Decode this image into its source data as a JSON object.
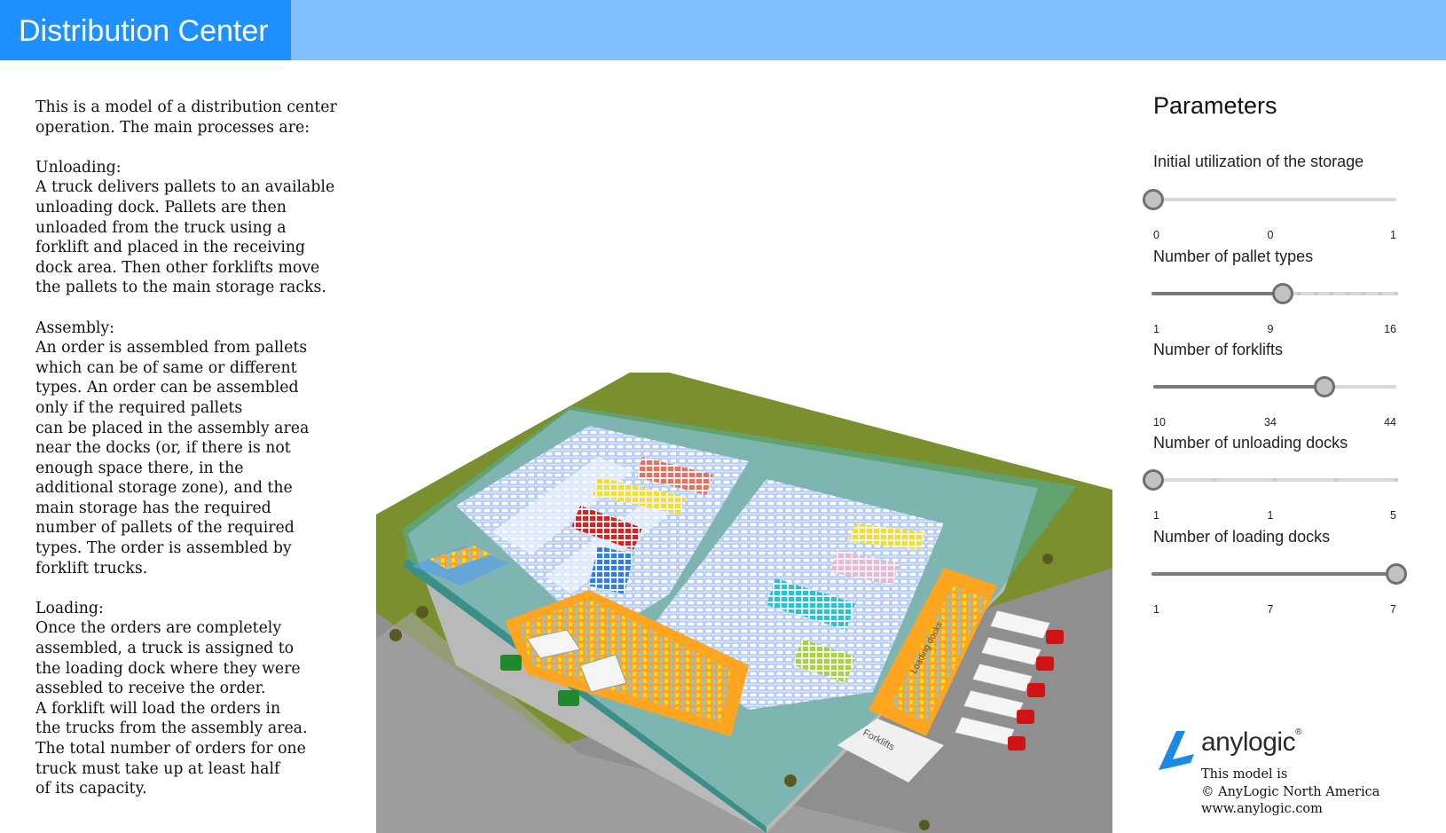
{
  "header": {
    "title": "Distribution Center"
  },
  "description": {
    "intro": "This is a model of a distribution center\noperation. The main processes are:",
    "unloading": "Unloading:\nA truck delivers pallets to an available\nunloading dock. Pallets are then\nunloaded from the truck using a\nforklift and placed in the receiving\ndock area. Then other forklifts move\nthe pallets to the main storage racks.",
    "assembly": "Assembly:\nAn order is assembled from pallets\nwhich can be of same or different\ntypes. An order can be assembled\nonly if the required pallets\ncan be placed in the assembly area\nnear the docks (or, if there is not\nenough space there, in the\nadditional storage zone), and the\nmain storage has the required\nnumber of pallets of the required\ntypes. The order is assembled by\nforklift trucks.",
    "loading": "Loading:\nOnce the orders are completely\nassembled, a truck is assigned to\nthe loading dock where they were\nassebled to receive the order.\nA forklift will load the orders in\nthe trucks from the assembly area.\nThe total number of orders for one\ntruck must take up at least half\nof its capacity."
  },
  "scene": {
    "forklifts_zone_label": "Forklifts",
    "loading_docks_label": "Loading docks"
  },
  "parameters": {
    "title": "Parameters",
    "items": [
      {
        "label": "Initial utilization of the storage",
        "min": "0",
        "value": "0",
        "max": "1",
        "fraction": 0.0,
        "steps": 0
      },
      {
        "label": "Number of pallet types",
        "min": "1",
        "value": "9",
        "max": "16",
        "fraction": 0.533,
        "steps": 15
      },
      {
        "label": "Number of forklifts",
        "min": "10",
        "value": "34",
        "max": "44",
        "fraction": 0.706,
        "steps": 0
      },
      {
        "label": "Number of unloading docks",
        "min": "1",
        "value": "1",
        "max": "5",
        "fraction": 0.0,
        "steps": 4
      },
      {
        "label": "Number of loading docks",
        "min": "1",
        "value": "7",
        "max": "7",
        "fraction": 1.0,
        "steps": 6
      }
    ]
  },
  "logo": {
    "brand": "anylogic",
    "mark": "®",
    "copyright": "This model is\n© AnyLogic North America\nwww.anylogic.com"
  },
  "colors": {
    "header_dark": "#1e90ff",
    "header_light": "#80c0ff",
    "grass": "#7a8f2e",
    "building_zone": "#4fb3aa",
    "assembly_zone": "#ffa51f",
    "logo_blue": "#1e88e5"
  }
}
